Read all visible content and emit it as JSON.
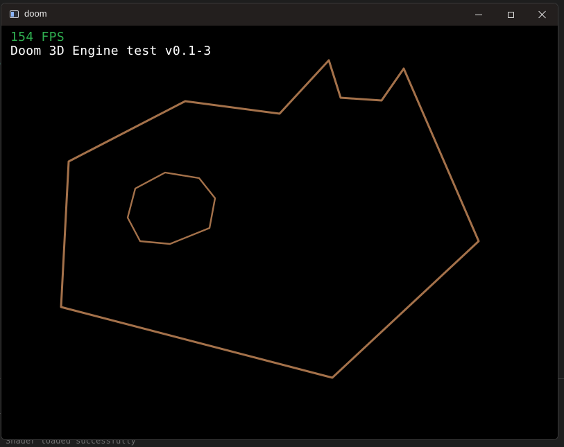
{
  "window": {
    "title": "doom",
    "minimize_icon": "minimize-icon",
    "maximize_icon": "maximize-icon",
    "close_icon": "close-icon"
  },
  "hud": {
    "fps": "154 FPS",
    "title": "Doom 3D Engine test v0.1-3"
  },
  "scene": {
    "wall_color": "#a4714a"
  },
  "background": {
    "status_text": "Shader loaded successfully"
  },
  "colors": {
    "fps_text": "#2fae50",
    "hud_text": "#ffffff",
    "titlebar": "#231f1e",
    "viewport_bg": "#000000"
  }
}
